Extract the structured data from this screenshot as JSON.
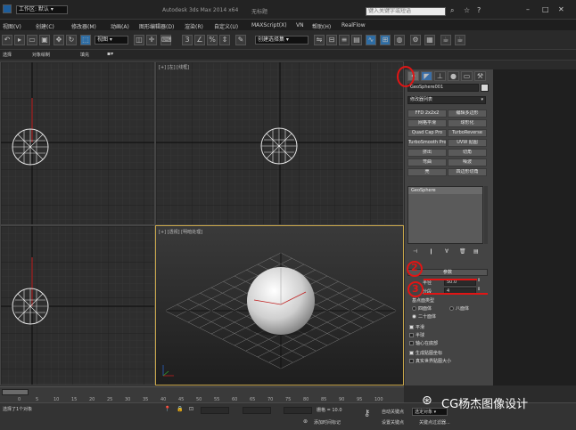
{
  "colors": {
    "accent_red": "#e01515",
    "panel_bg": "#444444",
    "viewport_bg": "#2e2e2e",
    "active_border": "#c7a54a",
    "sphere": "#d9d9d9"
  },
  "titlebar": {
    "workspace_label": "工作区: 默认",
    "title_text": "Autodesk 3ds Max 2014 x64",
    "title_suffix": "无标题",
    "search_placeholder": "键入关键字或短语"
  },
  "menu": {
    "items": [
      "视图(V)",
      "创建(C)",
      "修改器(M)",
      "动画(A)",
      "图形编辑器(D)",
      "渲染(R)",
      "自定义(U)",
      "MAXScript(X)",
      "VN",
      "帮助(H)",
      "RealFlow"
    ]
  },
  "toolbar": {
    "view_dropdown": "视图",
    "selection_set_dropdown": "创建选择集"
  },
  "ribbon": {
    "tabs": [
      "选择",
      "对象绘制",
      "填充"
    ]
  },
  "viewports": {
    "top_left_label": "[+] [左] [线框]",
    "top_right_label": "[+] [前] [线框]",
    "bottom_right_label": "[+] [透视] [明暗处理]"
  },
  "command_panel": {
    "object_name": "GeoSphere001",
    "modifier_list": "修改器列表",
    "modifier_buttons": [
      "FFD 2x2x2",
      "编辑多边形",
      "网格平滑",
      "球形化",
      "Quad Cap Pro",
      "TurboReverse",
      "TurboSmooth Pro",
      "UVW 贴图",
      "挤出",
      "切角",
      "弯曲",
      "噪波",
      "壳",
      "四边形切角"
    ],
    "stack_item": "GeoSphere",
    "params_title": "参数",
    "radius_label": "半径",
    "radius_value": "50.0",
    "segments_label": "分段",
    "segments_value": "4",
    "base_type_label": "基点面类型",
    "radio_tetra": "四面体",
    "radio_octa": "八面体",
    "radio_icosa": "二十面体",
    "check_smooth": "平滑",
    "check_hemisphere": "半球",
    "check_base_pivot": "轴心在底部",
    "check_gen_coords": "生成贴图坐标",
    "check_real_world": "真实世界贴图大小"
  },
  "timeline": {
    "ticks": [
      "0",
      "5",
      "10",
      "15",
      "20",
      "25",
      "30",
      "35",
      "40",
      "45",
      "50",
      "55",
      "60",
      "65",
      "70",
      "75",
      "80",
      "85",
      "90",
      "95",
      "100"
    ]
  },
  "status": {
    "selected_text": "选择了1个对象",
    "grid_label": "栅格 = 10.0",
    "add_time_tag": "添加时间标记",
    "auto_key": "自动关键点",
    "set_key": "设置关键点",
    "selected_dropdown": "选定对象",
    "key_filters": "关键点过滤器..."
  },
  "annotations": {
    "num_2": "2",
    "num_3": "3"
  },
  "watermark": {
    "text": "CG杨杰图像设计"
  }
}
